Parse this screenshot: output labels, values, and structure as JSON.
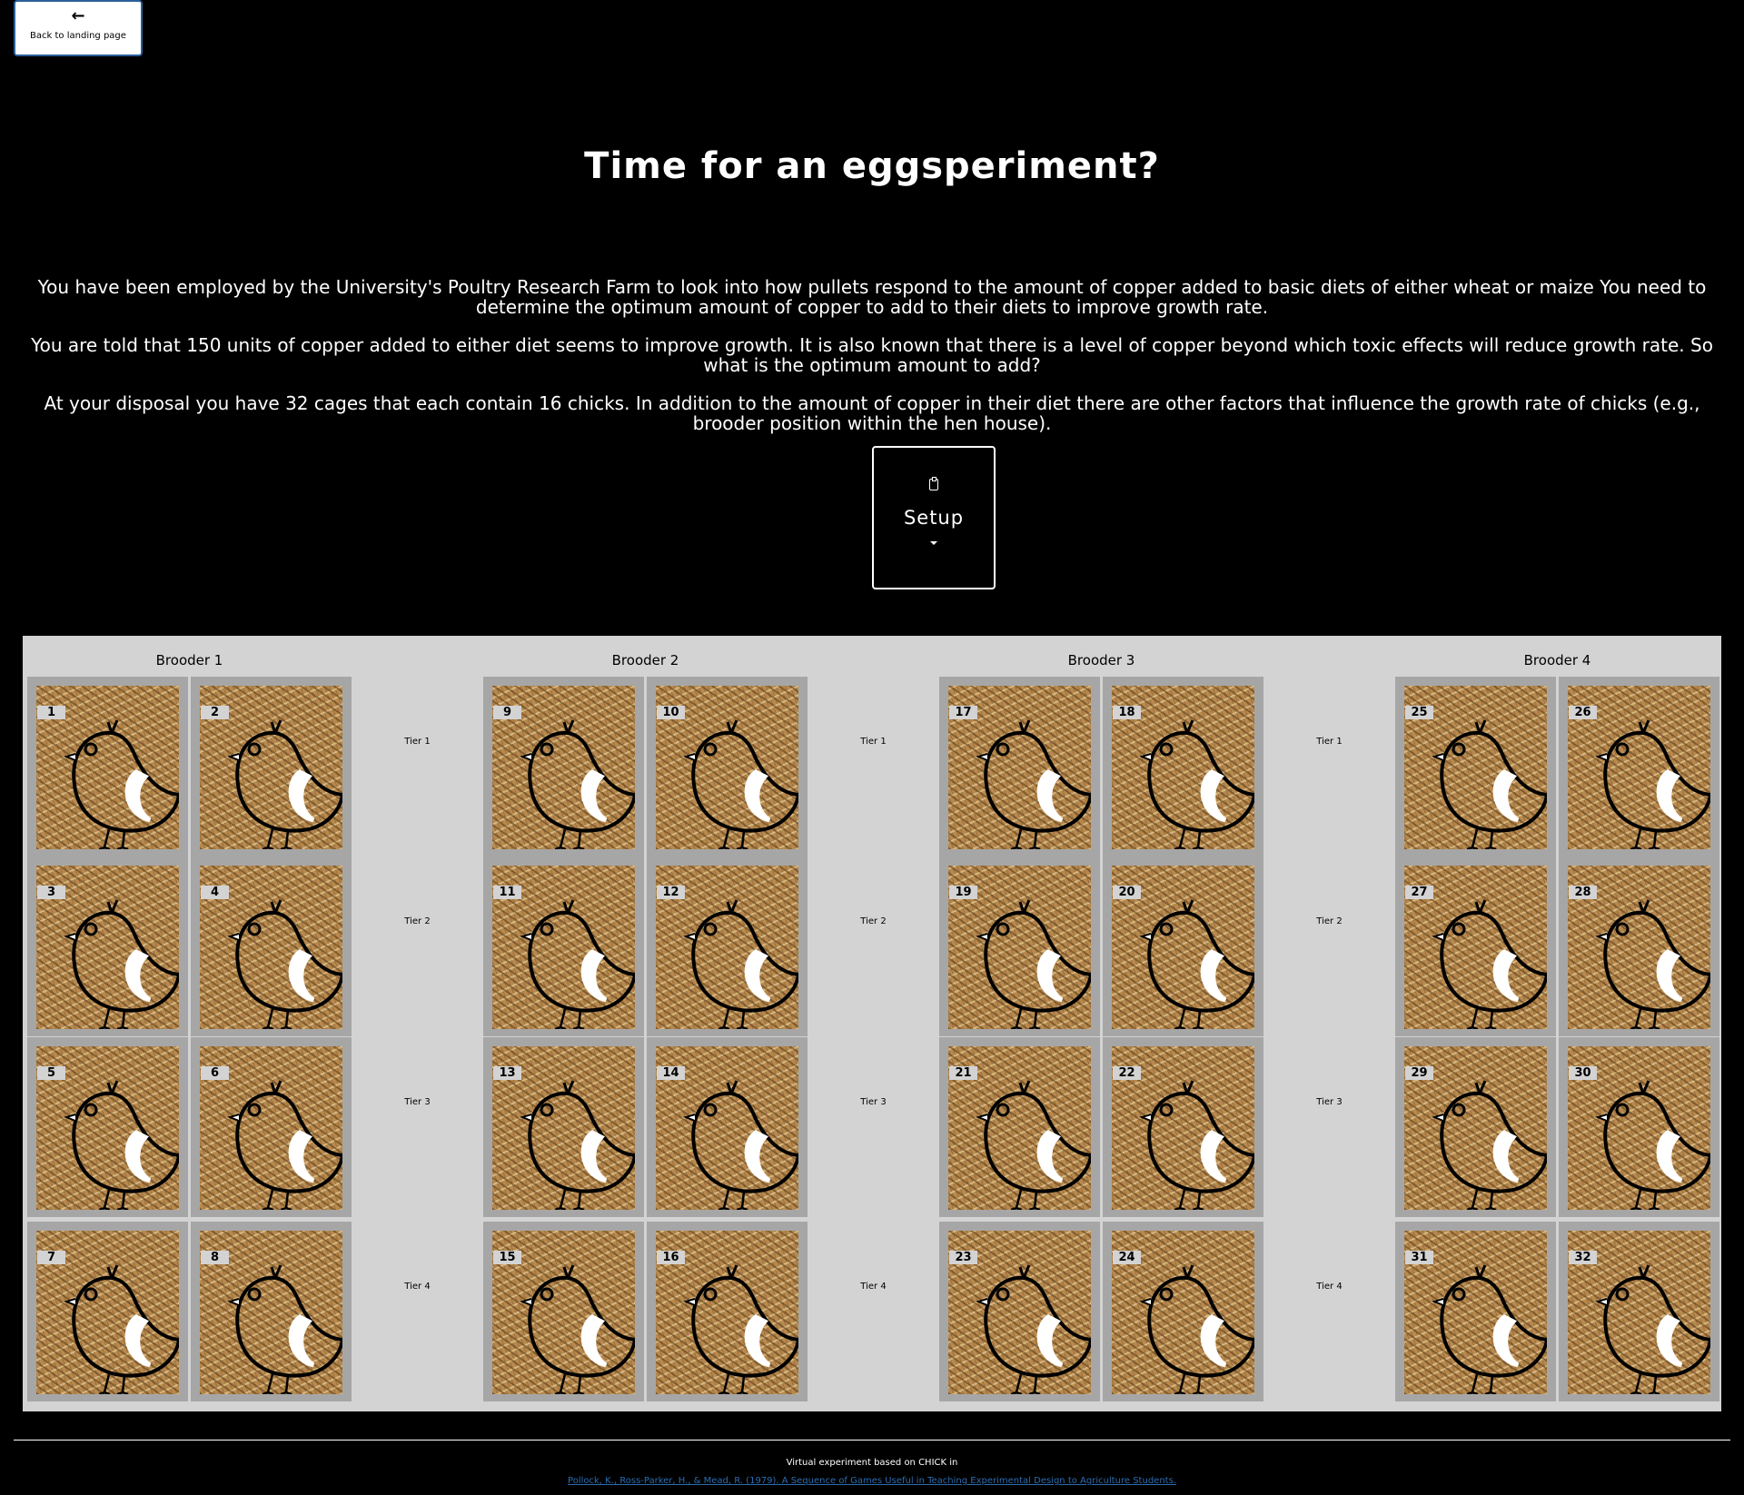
{
  "nav": {
    "back_label": "Back to landing page",
    "back_icon": "arrow-left-icon"
  },
  "title": "Time for an eggsperiment?",
  "intro": [
    "You have been employed by the University's Poultry Research Farm to look into how pullets respond to the amount of copper added to basic diets of either wheat or maize You need to determine the optimum amount of copper to add to their diets to improve growth rate.",
    "You are told that 150 units of copper added to either diet seems to improve growth. It is also known that there is a level of copper beyond which toxic effects will reduce growth rate. So what is the optimum amount to add?",
    "At your disposal you have 32 cages that each contain 16 chicks. In addition to the amount of copper in their diet there are other factors that influence the growth rate of chicks (e.g., brooder position within the hen house)."
  ],
  "setup": {
    "label": "Setup",
    "icon": "clipboard-icon"
  },
  "tiers": [
    "Tier 1",
    "Tier 2",
    "Tier 3",
    "Tier 4"
  ],
  "brooders": [
    {
      "name": "Brooder 1",
      "cages": [
        "1",
        "2",
        "3",
        "4",
        "5",
        "6",
        "7",
        "8"
      ]
    },
    {
      "name": "Brooder 2",
      "cages": [
        "9",
        "10",
        "11",
        "12",
        "13",
        "14",
        "15",
        "16"
      ]
    },
    {
      "name": "Brooder 3",
      "cages": [
        "17",
        "18",
        "19",
        "20",
        "21",
        "22",
        "23",
        "24"
      ]
    },
    {
      "name": "Brooder 4",
      "cages": [
        "25",
        "26",
        "27",
        "28",
        "29",
        "30",
        "31",
        "32"
      ]
    }
  ],
  "footer": {
    "credit": "Virtual experiment based on CHICK in",
    "citation": "Pollock, K., Ross-Parker, H., & Mead, R. (1979). A Sequence of Games Useful in Teaching Experimental Design to Agriculture Students."
  }
}
